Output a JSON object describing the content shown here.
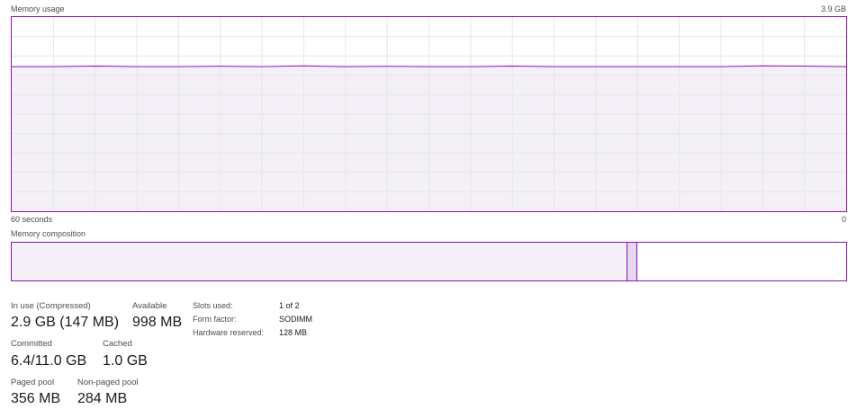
{
  "usage_graph": {
    "title": "Memory usage",
    "max_label": "3.9 GB",
    "x_left_label": "60 seconds",
    "x_right_label": "0",
    "line_color": "#8b12ae",
    "fill_color": "#f4f0f7",
    "grid_color": "#e6e6e6",
    "used_fraction": 0.745
  },
  "composition": {
    "title": "Memory composition",
    "in_use_fraction": 0.738,
    "modified_fraction": 0.012,
    "in_use_color": "#f4f0f7",
    "modified_color": "#e6d7ee",
    "border_color": "#8b12ae"
  },
  "stats": {
    "in_use": {
      "label": "In use (Compressed)",
      "value": "2.9 GB (147 MB)"
    },
    "available": {
      "label": "Available",
      "value": "998 MB"
    },
    "committed": {
      "label": "Committed",
      "value": "6.4/11.0 GB"
    },
    "cached": {
      "label": "Cached",
      "value": "1.0 GB"
    },
    "paged_pool": {
      "label": "Paged pool",
      "value": "356 MB"
    },
    "non_paged_pool": {
      "label": "Non-paged pool",
      "value": "284 MB"
    }
  },
  "info": {
    "slots_used": {
      "label": "Slots used:",
      "value": "1 of 2"
    },
    "form_factor": {
      "label": "Form factor:",
      "value": "SODIMM"
    },
    "hardware_reserved": {
      "label": "Hardware reserved:",
      "value": "128 MB"
    }
  }
}
